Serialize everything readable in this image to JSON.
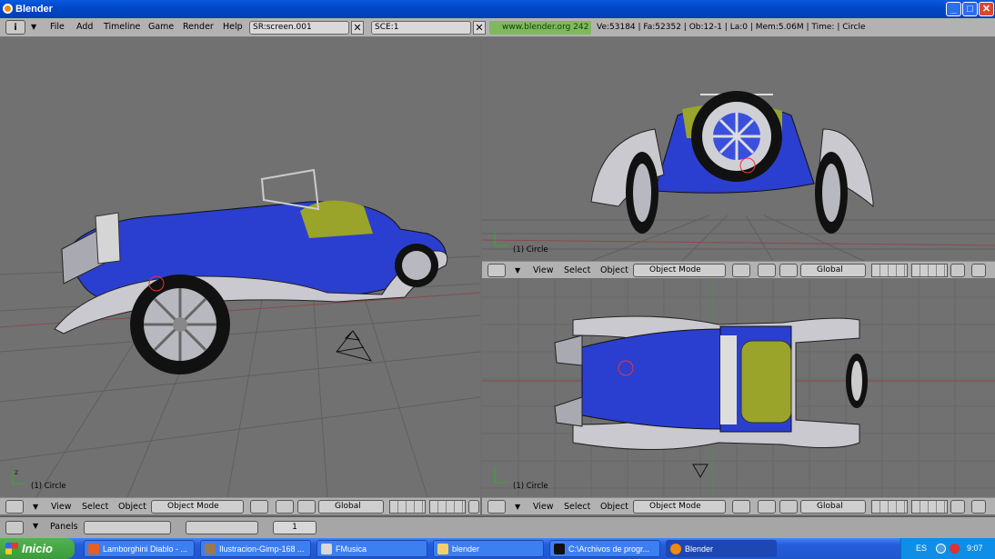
{
  "window": {
    "title": "Blender",
    "minimize": "_",
    "maximize": "□",
    "close": "✕"
  },
  "header": {
    "menu": [
      "File",
      "Add",
      "Timeline",
      "Game",
      "Render",
      "Help"
    ],
    "screen_field": "SR:screen.001",
    "scene_field": "SCE:1",
    "url": "www.blender.org 242",
    "stats": "Ve:53184 | Fa:52352 | Ob:12-1 | La:0  | Mem:5.06M | Time: | Circle"
  },
  "viewports": {
    "perspective": {
      "label": "(1) Circle"
    },
    "front": {
      "label": "(1) Circle"
    },
    "top": {
      "label": "(1) Circle"
    }
  },
  "viewport_header": {
    "view": "View",
    "select": "Select",
    "object": "Object",
    "mode": "Object Mode",
    "orientation": "Global"
  },
  "buttons_window": {
    "panels": "Panels",
    "frame": "1"
  },
  "taskbar": {
    "start": "Inicio",
    "tasks": [
      {
        "label": "Lamborghini Diablo - ...",
        "color": "#e0602a"
      },
      {
        "label": "Ilustracion-Gimp-168 ...",
        "color": "#9a7a52"
      },
      {
        "label": "FMusica",
        "color": "#d8d8d8"
      },
      {
        "label": "blender",
        "color": "#f2d16b"
      },
      {
        "label": "C:\\Archivos de progr...",
        "color": "#111111"
      },
      {
        "label": "Blender",
        "color": "#f08a10"
      }
    ],
    "lang": "ES",
    "time": "9:07"
  },
  "colors": {
    "car_body": "#2a3fcf",
    "seat": "#9aa32a",
    "grid_bg": "#717171"
  }
}
